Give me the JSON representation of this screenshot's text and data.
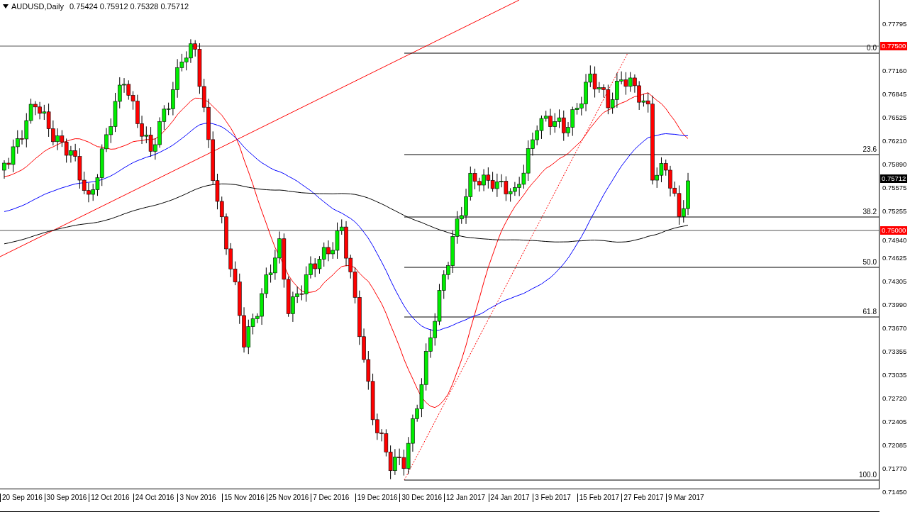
{
  "chart": {
    "symbol_label": "AUDUSD,Daily",
    "ohlc": "0.75424 0.75912 0.75328 0.75712",
    "price_axis": [
      "0.77795",
      "0.77160",
      "0.76845",
      "0.76525",
      "0.76210",
      "0.75890",
      "0.75575",
      "0.75255",
      "0.74940",
      "0.74625",
      "0.74305",
      "0.73990",
      "0.73670",
      "0.73355",
      "0.73035",
      "0.72720",
      "0.72405",
      "0.72085",
      "0.71770",
      "0.71450"
    ],
    "date_axis": [
      "20 Sep 2016",
      "30 Sep 2016",
      "12 Oct 2016",
      "24 Oct 2016",
      "3 Nov 2016",
      "15 Nov 2016",
      "25 Nov 2016",
      "7 Dec 2016",
      "19 Dec 2016",
      "30 Dec 2016",
      "12 Jan 2017",
      "24 Jan 2017",
      "3 Feb 2017",
      "15 Feb 2017",
      "27 Feb 2017",
      "9 Mar 2017"
    ],
    "fibonacci_levels": [
      "0.0",
      "23.6",
      "38.2",
      "50.0",
      "61.8",
      "100.0"
    ],
    "price_tags": [
      {
        "text": "0.77500",
        "kind": "alert"
      },
      {
        "text": "0.75712",
        "kind": "bid"
      },
      {
        "text": "0.75000",
        "kind": "alert"
      }
    ]
  }
}
